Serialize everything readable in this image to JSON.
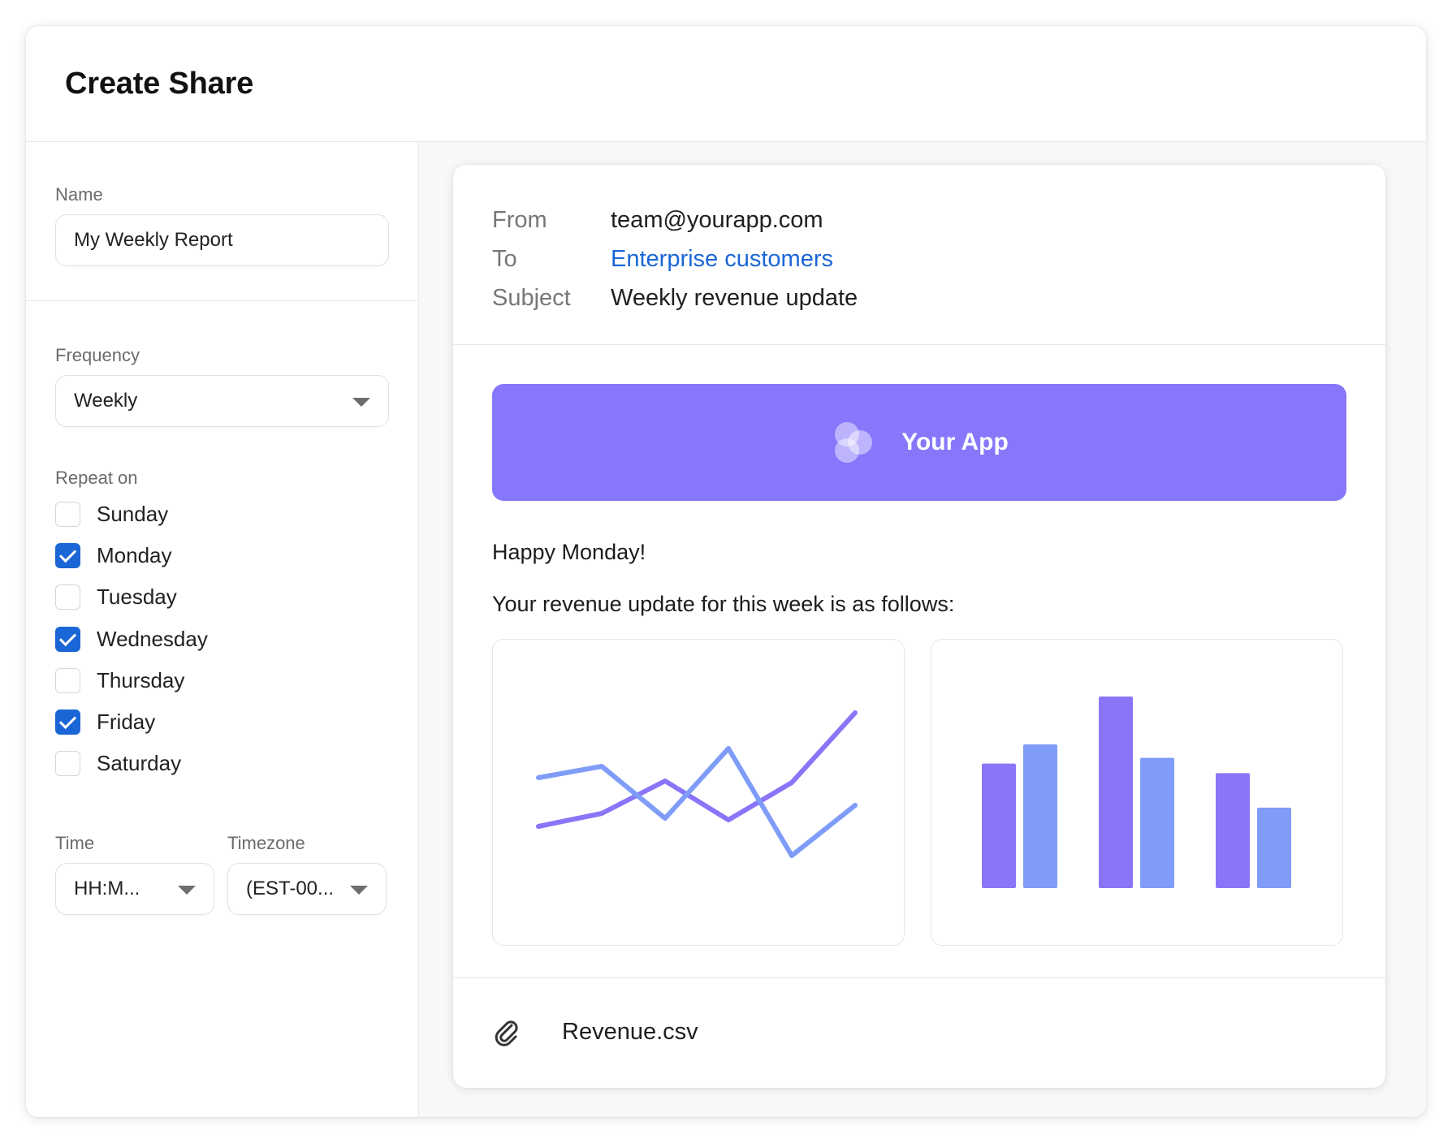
{
  "title": "Create Share",
  "form": {
    "name_label": "Name",
    "name_value": "My Weekly Report",
    "frequency_label": "Frequency",
    "frequency_value": "Weekly",
    "repeat_label": "Repeat on",
    "days": [
      {
        "label": "Sunday",
        "checked": false
      },
      {
        "label": "Monday",
        "checked": true
      },
      {
        "label": "Tuesday",
        "checked": false
      },
      {
        "label": "Wednesday",
        "checked": true
      },
      {
        "label": "Thursday",
        "checked": false
      },
      {
        "label": "Friday",
        "checked": true
      },
      {
        "label": "Saturday",
        "checked": false
      }
    ],
    "time_label": "Time",
    "time_value": "HH:M...",
    "timezone_label": "Timezone",
    "timezone_value": "(EST-00..."
  },
  "email": {
    "from_label": "From",
    "from_value": "team@yourapp.com",
    "to_label": "To",
    "to_value": "Enterprise customers",
    "subject_label": "Subject",
    "subject_value": "Weekly revenue update",
    "banner_text": "Your App",
    "greeting": "Happy Monday!",
    "intro": "Your revenue update for this week is as follows:",
    "attachment": "Revenue.csv"
  },
  "colors": {
    "accent": "#1b66d6",
    "banner": "#8777fb",
    "series_purple": "#8a75f9",
    "series_blue": "#7f9cf8"
  },
  "icons": {
    "logo": "app-logo-icon",
    "attachment": "paperclip-icon",
    "dropdown": "chevron-down-icon",
    "check": "checkmark-icon"
  },
  "chart_data": [
    {
      "type": "line",
      "x": [
        0,
        1,
        2,
        3,
        4,
        5
      ],
      "series": [
        {
          "values": [
            2.0,
            2.8,
            4.8,
            2.4,
            4.7,
            9.0
          ]
        },
        {
          "values": [
            5.0,
            5.7,
            2.5,
            6.8,
            0.2,
            3.3
          ]
        }
      ],
      "ylim": [
        0,
        10
      ]
    },
    {
      "type": "bar",
      "categories": [
        "1",
        "2",
        "3"
      ],
      "series": [
        {
          "values": [
            6.5,
            10.0,
            6.0
          ]
        },
        {
          "values": [
            7.5,
            6.8,
            4.2
          ]
        }
      ],
      "ylim": [
        0,
        10
      ]
    }
  ]
}
